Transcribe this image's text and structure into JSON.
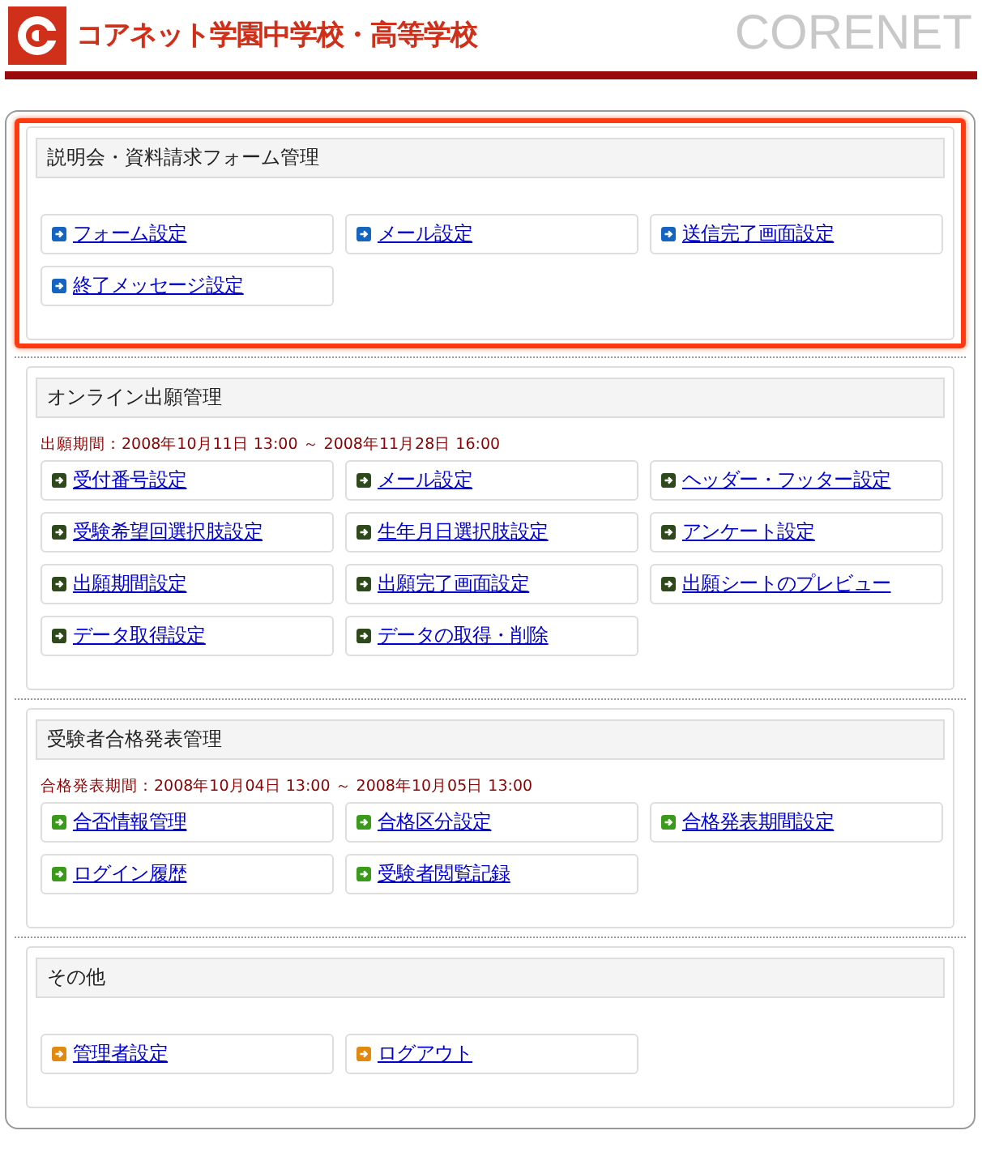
{
  "header": {
    "logo_text": "コアネット学園中学校・高等学校",
    "brand": "CORENET"
  },
  "sections": [
    {
      "title": "説明会・資料請求フォーム管理",
      "highlighted": true,
      "color": "#1565c0",
      "links": [
        "フォーム設定",
        "メール設定",
        "送信完了画面設定",
        "終了メッセージ設定"
      ]
    },
    {
      "title": "オンライン出願管理",
      "highlighted": false,
      "color": "#2e4a1a",
      "period": "出願期間：2008年10月11日 13:00 ～ 2008年11月28日 16:00",
      "links": [
        "受付番号設定",
        "メール設定",
        "ヘッダー・フッター設定",
        "受験希望回選択肢設定",
        "生年月日選択肢設定",
        "アンケート設定",
        "出願期間設定",
        "出願完了画面設定",
        "出願シートのプレビュー",
        "データ取得設定",
        "データの取得・削除"
      ]
    },
    {
      "title": "受験者合格発表管理",
      "highlighted": false,
      "color": "#3a9a1a",
      "period": "合格発表期間：2008年10月04日 13:00 ～ 2008年10月05日 13:00",
      "links": [
        "合否情報管理",
        "合格区分設定",
        "合格発表期間設定",
        "ログイン履歴",
        "受験者閲覧記録"
      ]
    },
    {
      "title": "その他",
      "highlighted": false,
      "color": "#e08a10",
      "links": [
        "管理者設定",
        "ログアウト"
      ]
    }
  ]
}
